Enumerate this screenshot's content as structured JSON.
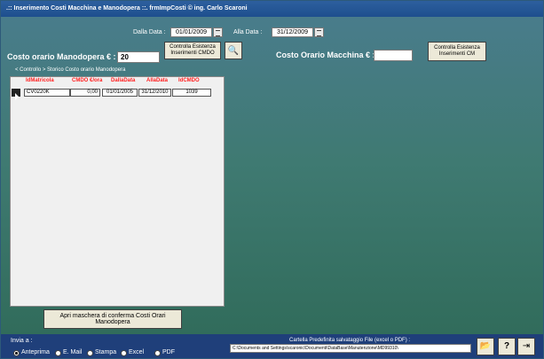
{
  "window": {
    "title": ".:: Inserimento Costi Macchina e Manodopera ::.   frmImpCosti © ing. Carlo Scaroni"
  },
  "filters": {
    "dalla_label": "Dalla Data :",
    "dalla_value": "01/01/2009",
    "alla_label": "Alla Data :",
    "alla_value": "31/12/2009"
  },
  "buttons": {
    "controlla_cmdo": "Controlla Esistenza Inserimenti CMDO",
    "controlla_cm": "Controlla Esistenza Inserimenti CM",
    "apri_maschera": "Apri maschera di conferma Costi Orari Manodopera"
  },
  "costo_manodopera": {
    "label": "Costo orario Manodopera € :",
    "value": "20"
  },
  "costo_macchina": {
    "label": "Costo Orario Macchina € :",
    "value": ""
  },
  "storico": {
    "title": "< Controllo > Storico Costo orario Manodopera",
    "columns": [
      "IdMatricola",
      "CMDO €/ora",
      "DallaData",
      "AllaData",
      "IdCMDO"
    ],
    "rows": [
      [
        "CV0220K",
        "0,00",
        "01/01/2005",
        "31/12/2010",
        "1039"
      ]
    ]
  },
  "invia": {
    "label": "Invia a :",
    "options": [
      "Anteprima",
      "E. Mail",
      "Stampa",
      "Excel",
      "PDF"
    ],
    "selected": "Anteprima"
  },
  "cartella": {
    "label": "Cartella Predefinita salvataggio File (excel o PDF) :",
    "path": "C:\\Documents and Settings\\scaronic\\Documenti\\DataBase\\Manutenzione\\MD99310\\"
  },
  "icons": [
    "folder-icon",
    "help-icon",
    "exit-icon",
    "preview-icon"
  ]
}
